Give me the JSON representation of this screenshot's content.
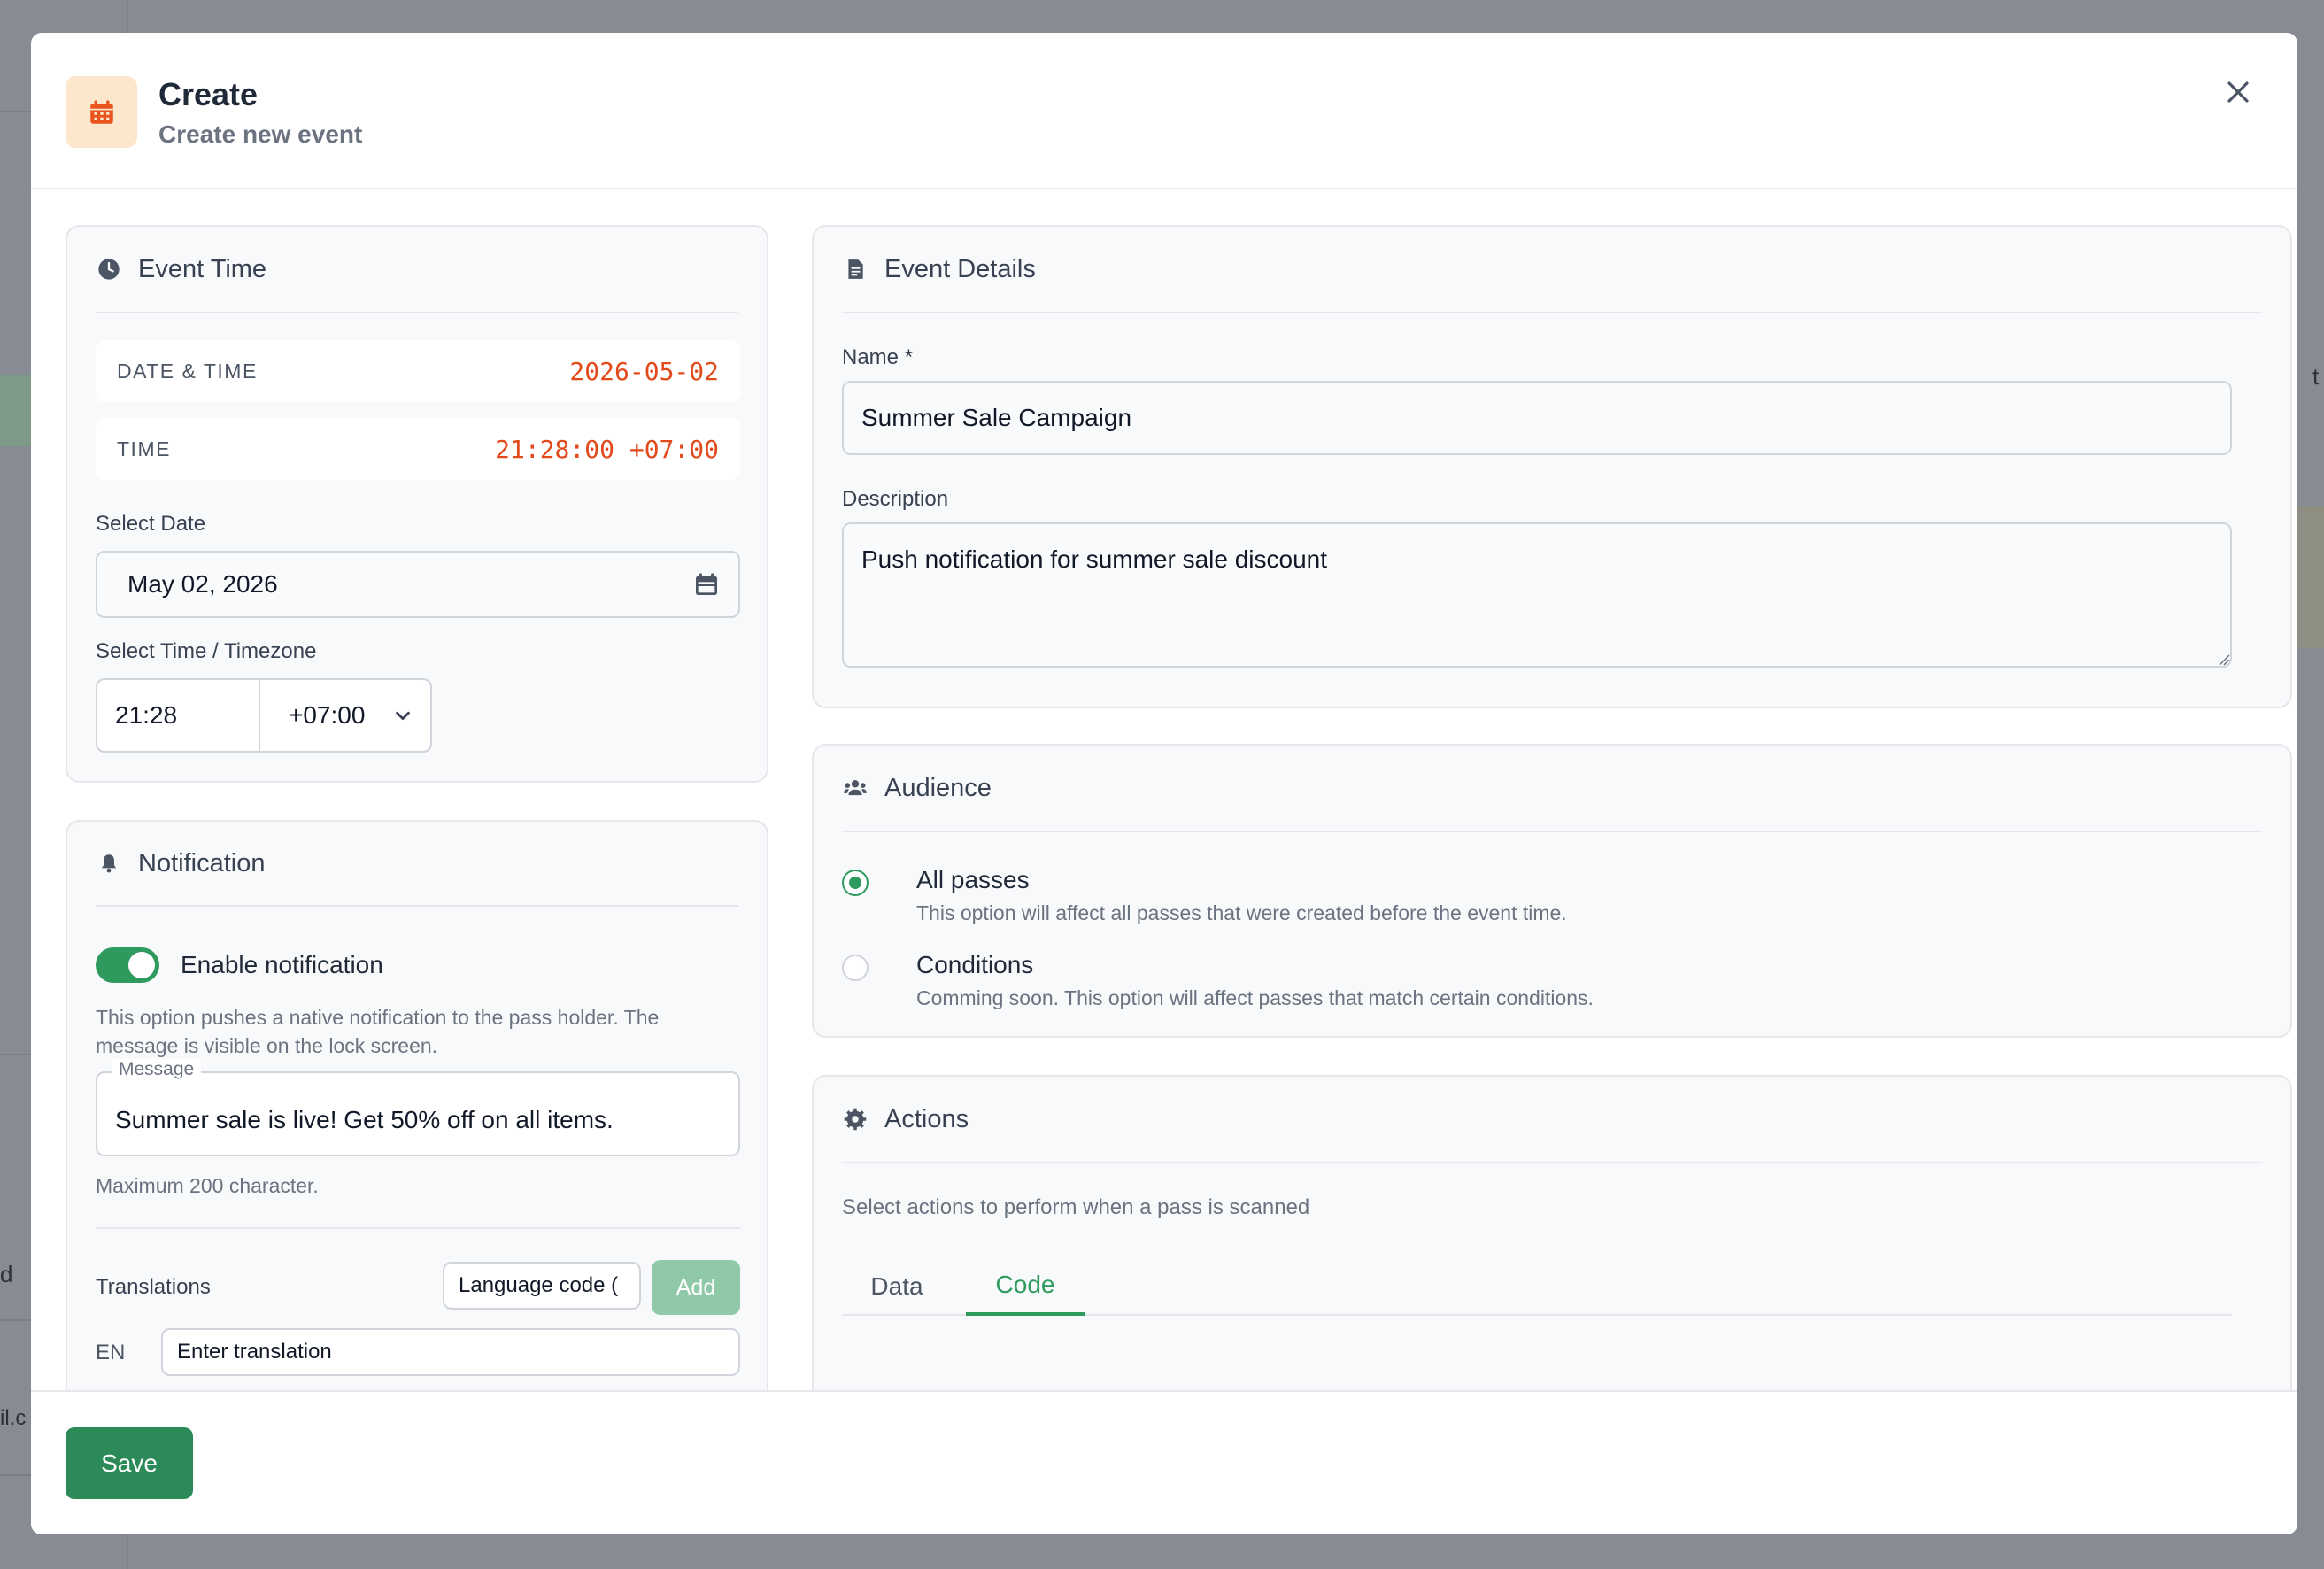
{
  "modal": {
    "title": "Create",
    "subtitle": "Create new event"
  },
  "event_time": {
    "title": "Event Time",
    "date_time_label": "DATE & TIME",
    "date_time_value": "2026-05-02",
    "time_label": "TIME",
    "time_value": "21:28:00 +07:00",
    "select_date_label": "Select Date",
    "select_date_value": "May 02, 2026",
    "select_time_label": "Select Time / Timezone",
    "time_input": "21:28",
    "timezone": "+07:00"
  },
  "notification": {
    "title": "Notification",
    "toggle_label": "Enable notification",
    "enabled": true,
    "help_line1": "This option pushes a native notification to the pass holder. The",
    "help_line2": "message is visible on the lock screen.",
    "message_label": "Message",
    "message_value": "Summer sale is live! Get 50% off on all items.",
    "max_chars": "Maximum 200 character.",
    "translations_label": "Translations",
    "language_placeholder": "Language code (",
    "add_label": "Add",
    "lang_code": "EN",
    "translation_placeholder": "Enter translation"
  },
  "event_details": {
    "title": "Event Details",
    "name_label": "Name *",
    "name_value": "Summer Sale Campaign",
    "description_label": "Description",
    "description_value": "Push notification for summer sale discount"
  },
  "audience": {
    "title": "Audience",
    "options": [
      {
        "label": "All passes",
        "desc": "This option will affect all passes that were created before the event time."
      },
      {
        "label": "Conditions",
        "desc": "Comming soon. This option will affect passes that match certain conditions."
      }
    ]
  },
  "actions": {
    "title": "Actions",
    "help": "Select actions to perform when a pass is scanned",
    "tabs": [
      {
        "label": "Data"
      },
      {
        "label": "Code"
      }
    ]
  },
  "footer": {
    "save_label": "Save"
  },
  "background": {
    "left_letter": "d",
    "left_email_fragment": "il.c",
    "right_letter": "t"
  },
  "colors": {
    "accent_green": "#2e9a5e",
    "mono_orange": "#e24a1c",
    "icon_orange": "#e8541c"
  }
}
